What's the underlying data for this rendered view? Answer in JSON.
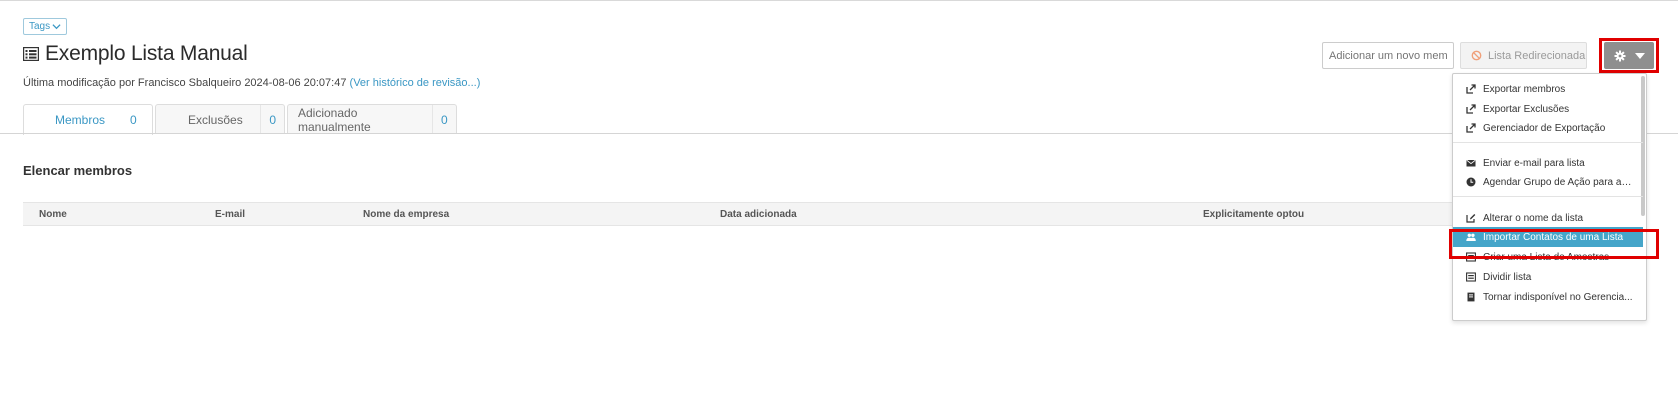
{
  "header": {
    "tags_label": "Tags",
    "title": "Exemplo Lista Manual",
    "modified_text": "Última modificação por Francisco Sbalqueiro 2024-08-06 20:07:47",
    "history_link": "(Ver histórico de revisão...)"
  },
  "toolbar": {
    "add_member_placeholder": "Adicionar um novo meml",
    "redirect_label": "Lista Redirecionada"
  },
  "tabs": [
    {
      "label": "Membros",
      "count": "0"
    },
    {
      "label": "Exclusões",
      "count": "0"
    },
    {
      "label": "Adicionado manualmente",
      "count": "0"
    }
  ],
  "main": {
    "section_title": "Elencar membros",
    "columns": [
      "Nome",
      "E-mail",
      "Nome da empresa",
      "Data adicionada",
      "Explicitamente optou"
    ]
  },
  "menu": {
    "items": [
      {
        "label": "Exportar membros",
        "icon": "export-icon"
      },
      {
        "label": "Exportar Exclusões",
        "icon": "export-icon"
      },
      {
        "label": "Gerenciador de Exportação",
        "icon": "export-icon"
      },
      {
        "label": "Enviar e-mail para lista",
        "icon": "envelope-icon"
      },
      {
        "label": "Agendar Grupo de Ação para a li...",
        "icon": "clock-icon"
      },
      {
        "label": "Alterar o nome da lista",
        "icon": "edit-icon"
      },
      {
        "label": "Importar Contatos de uma Lista",
        "icon": "users-icon"
      },
      {
        "label": "Criar uma Lista de Amostras",
        "icon": "list-icon"
      },
      {
        "label": "Dividir lista",
        "icon": "list-icon"
      },
      {
        "label": "Tornar indisponível no Gerencia...",
        "icon": "document-icon"
      }
    ]
  },
  "colors": {
    "accent": "#3a97c4",
    "menu_highlight": "#45a5c9",
    "annotation_red": "#e00000"
  }
}
